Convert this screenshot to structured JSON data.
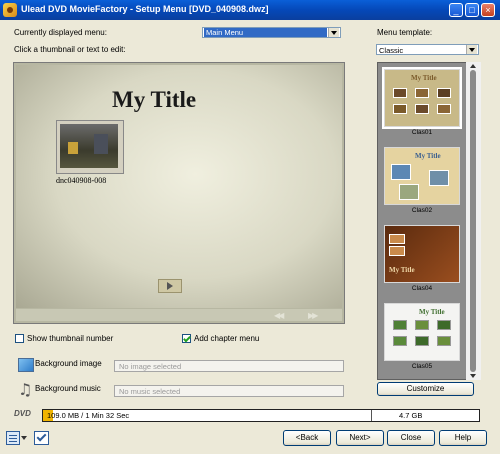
{
  "window": {
    "title": "Ulead DVD MovieFactory - Setup Menu    [DVD_040908.dwz]",
    "controls": {
      "minimize": "_",
      "maximize": "□",
      "close": "×"
    }
  },
  "menu_selector": {
    "label": "Currently displayed menu:",
    "value": "Main Menu",
    "hint": "Click a thumbnail or text to edit:"
  },
  "preview": {
    "title": "My Title",
    "thumbnail_label": "dnc040908-008",
    "nav_prev": "◀◀",
    "nav_next": "▶▶"
  },
  "options": {
    "show_thumbnail_number": {
      "label": "Show thumbnail number",
      "checked": false
    },
    "add_chapter_menu": {
      "label": "Add chapter menu",
      "checked": true
    }
  },
  "background": {
    "image_label": "Background image",
    "image_value": "No image selected",
    "music_label": "Background music",
    "music_value": "No music selected"
  },
  "templates": {
    "label": "Menu template:",
    "category": "Classic",
    "items": [
      {
        "name": "Clas01",
        "title": "My Title",
        "bg": "#c8b988",
        "accent": "#7a5a2a"
      },
      {
        "name": "Clas02",
        "title": "My Title",
        "bg": "#e5d3a0",
        "accent": "#3a5f8f"
      },
      {
        "name": "Clas04",
        "title": "My Title",
        "bg": "#7a3b16",
        "accent": "#c98a4b"
      },
      {
        "name": "Clas05",
        "title": "My Title",
        "bg": "#f4f4f2",
        "accent": "#3f6e2f"
      }
    ],
    "customize": "Customize"
  },
  "disk": {
    "format": "DVD",
    "used": "109.0 MB / 1 Min 32 Sec",
    "capacity": "4.7 GB",
    "used_fraction": 0.023
  },
  "buttons": {
    "back": "<Back",
    "next": "Next>",
    "close": "Close",
    "help": "Help"
  }
}
